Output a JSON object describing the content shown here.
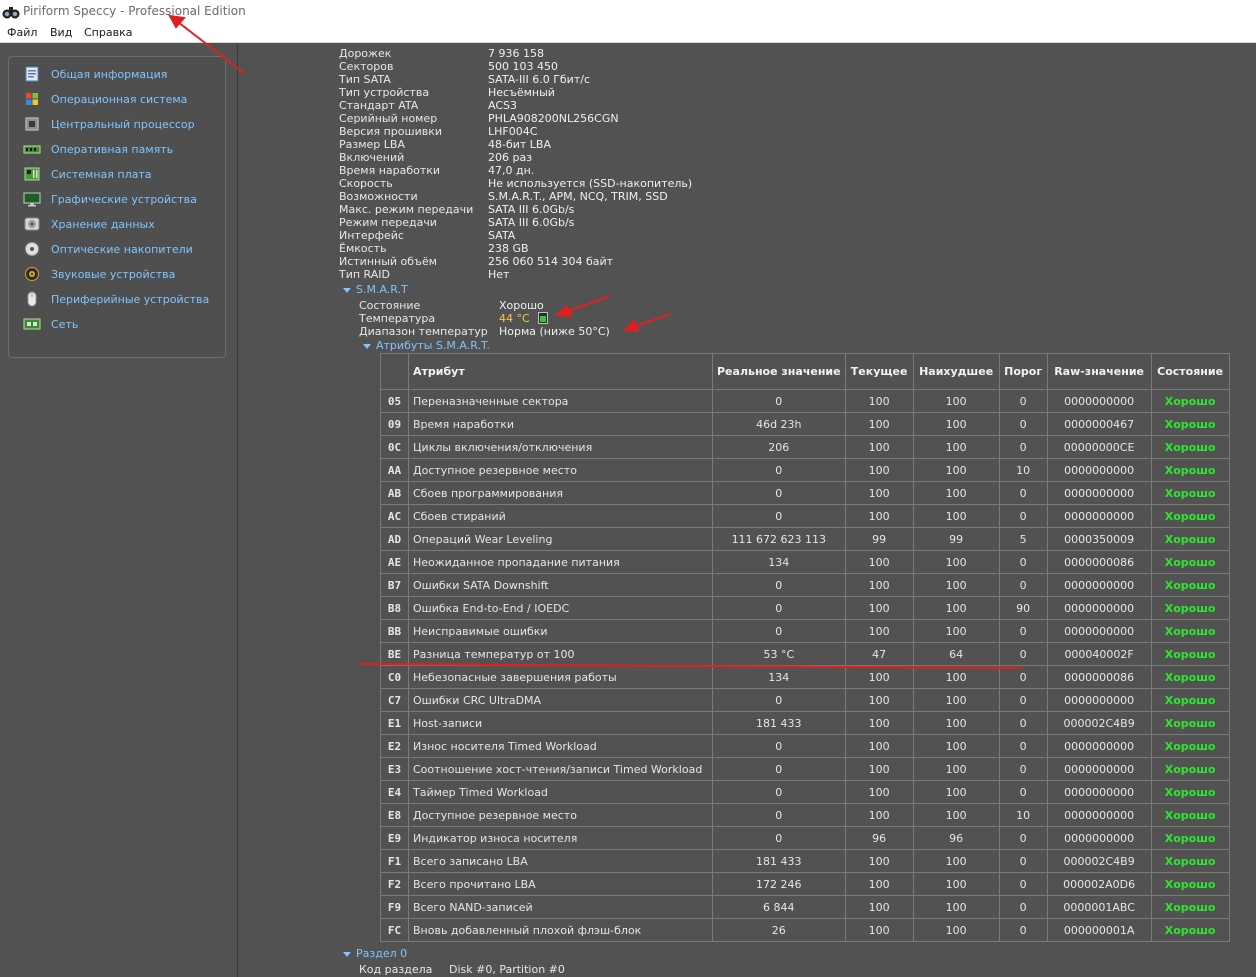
{
  "window": {
    "title": "Piriform Speccy - Professional Edition",
    "menu": [
      "Файл",
      "Вид",
      "Справка"
    ]
  },
  "colors": {
    "accent": "#7fc5ff",
    "good": "#2fe62f",
    "temperature": "#f5c84a",
    "annotation": "#e02020"
  },
  "sidebar": {
    "items": [
      {
        "label": "Общая информация",
        "icon": "summary-icon"
      },
      {
        "label": "Операционная система",
        "icon": "windows-icon"
      },
      {
        "label": "Центральный процессор",
        "icon": "cpu-icon"
      },
      {
        "label": "Оперативная память",
        "icon": "ram-icon"
      },
      {
        "label": "Системная плата",
        "icon": "motherboard-icon"
      },
      {
        "label": "Графические устройства",
        "icon": "monitor-icon"
      },
      {
        "label": "Хранение данных",
        "icon": "storage-icon"
      },
      {
        "label": "Оптические накопители",
        "icon": "optical-disc-icon"
      },
      {
        "label": "Звуковые устройства",
        "icon": "speaker-icon"
      },
      {
        "label": "Периферийные устройства",
        "icon": "mouse-icon"
      },
      {
        "label": "Сеть",
        "icon": "network-icon"
      }
    ]
  },
  "drive": {
    "properties": [
      {
        "key": "Дорожек",
        "value": "7 936 158"
      },
      {
        "key": "Секторов",
        "value": "500 103 450"
      },
      {
        "key": "Тип SATA",
        "value": "SATA-III 6.0 Гбит/с"
      },
      {
        "key": "Тип устройства",
        "value": "Несъёмный"
      },
      {
        "key": "Стандарт ATA",
        "value": "ACS3"
      },
      {
        "key": "Серийный номер",
        "value": "PHLA908200NL256CGN"
      },
      {
        "key": "Версия прошивки",
        "value": "LHF004C"
      },
      {
        "key": "Размер LBA",
        "value": "48-бит LBA"
      },
      {
        "key": "Включений",
        "value": "206 раз"
      },
      {
        "key": "Время наработки",
        "value": "47,0 дн."
      },
      {
        "key": "Скорость",
        "value": "Не используется (SSD-накопитель)"
      },
      {
        "key": "Возможности",
        "value": "S.M.A.R.T., APM, NCQ, TRIM, SSD"
      },
      {
        "key": "Макс. режим передачи",
        "value": "SATA III 6.0Gb/s"
      },
      {
        "key": "Режим передачи",
        "value": "SATA III 6.0Gb/s"
      },
      {
        "key": "Интерфейс",
        "value": "SATA"
      },
      {
        "key": "Ёмкость",
        "value": "238 GB"
      },
      {
        "key": "Истинный объём",
        "value": "256 060 514 304 байт"
      },
      {
        "key": "Тип RAID",
        "value": "Нет"
      }
    ]
  },
  "smart": {
    "heading": "S.M.A.R.T",
    "status_key": "Состояние",
    "status_value": "Хорошо",
    "temp_key": "Температура",
    "temp_value": "44 °C",
    "range_key": "Диапазон температур",
    "range_value": "Норма (ниже 50°C)",
    "attributes_heading": "Атрибуты S.M.A.R.T.",
    "columns": [
      "Атрибут",
      "Реальное значение",
      "Текущее",
      "Наихудшее",
      "Порог",
      "Raw-значение",
      "Состояние"
    ],
    "rows": [
      [
        "05",
        "Переназначенные сектора",
        "0",
        "100",
        "100",
        "0",
        "0000000000",
        "Хорошо"
      ],
      [
        "09",
        "Время наработки",
        "46d 23h",
        "100",
        "100",
        "0",
        "0000000467",
        "Хорошо"
      ],
      [
        "0C",
        "Циклы включения/отключения",
        "206",
        "100",
        "100",
        "0",
        "00000000CE",
        "Хорошо"
      ],
      [
        "AA",
        "Доступное резервное место",
        "0",
        "100",
        "100",
        "10",
        "0000000000",
        "Хорошо"
      ],
      [
        "AB",
        "Сбоев программирования",
        "0",
        "100",
        "100",
        "0",
        "0000000000",
        "Хорошо"
      ],
      [
        "AC",
        "Сбоев стираний",
        "0",
        "100",
        "100",
        "0",
        "0000000000",
        "Хорошо"
      ],
      [
        "AD",
        "Операций Wear Leveling",
        "111 672 623 113",
        "99",
        "99",
        "5",
        "0000350009",
        "Хорошо"
      ],
      [
        "AE",
        "Неожиданное пропадание питания",
        "134",
        "100",
        "100",
        "0",
        "0000000086",
        "Хорошо"
      ],
      [
        "B7",
        "Ошибки SATA Downshift",
        "0",
        "100",
        "100",
        "0",
        "0000000000",
        "Хорошо"
      ],
      [
        "B8",
        "Ошибка End-to-End / IOEDC",
        "0",
        "100",
        "100",
        "90",
        "0000000000",
        "Хорошо"
      ],
      [
        "BB",
        "Неисправимые ошибки",
        "0",
        "100",
        "100",
        "0",
        "0000000000",
        "Хорошо"
      ],
      [
        "BE",
        "Разница температур от 100",
        "53 °C",
        "47",
        "64",
        "0",
        "000040002F",
        "Хорошо"
      ],
      [
        "C0",
        "Небезопасные завершения работы",
        "134",
        "100",
        "100",
        "0",
        "0000000086",
        "Хорошо"
      ],
      [
        "C7",
        "Ошибки CRC UltraDMA",
        "0",
        "100",
        "100",
        "0",
        "0000000000",
        "Хорошо"
      ],
      [
        "E1",
        "Host-записи",
        "181 433",
        "100",
        "100",
        "0",
        "000002C4B9",
        "Хорошо"
      ],
      [
        "E2",
        "Износ носителя Timed Workload",
        "0",
        "100",
        "100",
        "0",
        "0000000000",
        "Хорошо"
      ],
      [
        "E3",
        "Соотношение хост-чтения/записи Timed Workload",
        "0",
        "100",
        "100",
        "0",
        "0000000000",
        "Хорошо"
      ],
      [
        "E4",
        "Таймер Timed Workload",
        "0",
        "100",
        "100",
        "0",
        "0000000000",
        "Хорошо"
      ],
      [
        "E8",
        "Доступное резервное место",
        "0",
        "100",
        "100",
        "10",
        "0000000000",
        "Хорошо"
      ],
      [
        "E9",
        "Индикатор износа носителя",
        "0",
        "96",
        "96",
        "0",
        "0000000000",
        "Хорошо"
      ],
      [
        "F1",
        "Всего записано LBA",
        "181 433",
        "100",
        "100",
        "0",
        "000002C4B9",
        "Хорошо"
      ],
      [
        "F2",
        "Всего прочитано LBA",
        "172 246",
        "100",
        "100",
        "0",
        "000002A0D6",
        "Хорошо"
      ],
      [
        "F9",
        "Всего NAND-записей",
        "6 844",
        "100",
        "100",
        "0",
        "0000001ABC",
        "Хорошо"
      ],
      [
        "FC",
        "Вновь добавленный плохой флэш-блок",
        "26",
        "100",
        "100",
        "0",
        "000000001A",
        "Хорошо"
      ]
    ]
  },
  "partition": {
    "heading": "Раздел 0",
    "code_key": "Код раздела",
    "code_value": "Disk #0, Partition #0"
  }
}
